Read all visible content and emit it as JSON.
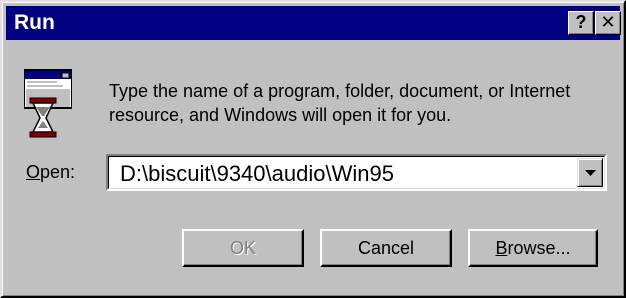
{
  "window": {
    "title": "Run",
    "help_label": "?",
    "close_label": "✕"
  },
  "message": "Type the name of a program, folder, document, or Internet resource, and Windows will open it for you.",
  "open_field": {
    "label_accel": "O",
    "label_rest": "pen:",
    "value": "D:\\biscuit\\9340\\audio\\Win95"
  },
  "buttons": {
    "ok": "OK",
    "cancel": "Cancel",
    "browse_accel": "B",
    "browse_rest": "rowse..."
  },
  "icons": [
    "run-program-icon",
    "hourglass-icon",
    "dropdown-arrow-icon",
    "help-icon",
    "close-icon"
  ]
}
